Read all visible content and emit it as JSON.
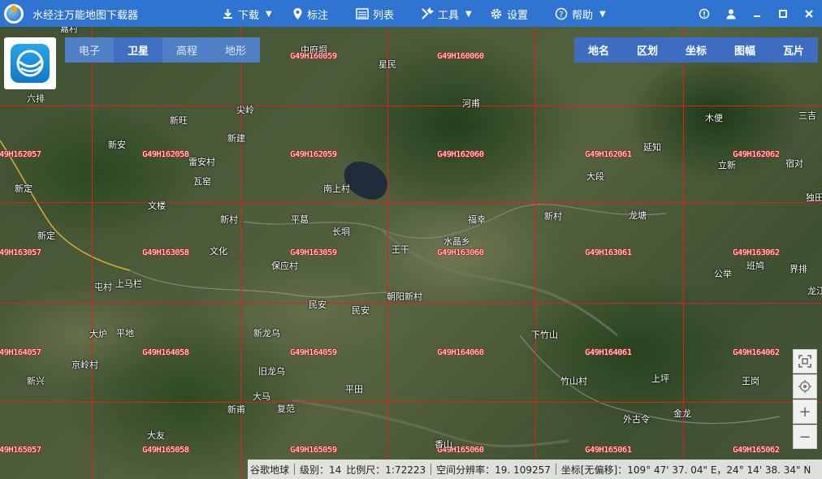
{
  "app": {
    "title": "水经注万能地图下载器"
  },
  "toolbar": {
    "download": "下载",
    "annotate": "标注",
    "list": "列表",
    "tools": "工具",
    "settings": "设置",
    "help": "帮助"
  },
  "map_types": [
    "电子",
    "卫星",
    "高程",
    "地形"
  ],
  "map_type_active": "卫星",
  "right_tools": [
    "地名",
    "区划",
    "坐标",
    "图幅",
    "瓦片"
  ],
  "tile_codes": [
    "G49H160059",
    "G49H160060",
    "G49H162057",
    "G49H162058",
    "G49H162059",
    "G49H162060",
    "G49H162061",
    "G49H162062",
    "G49H163057",
    "G49H163058",
    "G49H163059",
    "G49H163060",
    "G49H163061",
    "G49H163062",
    "G49H164057",
    "G49H164058",
    "G49H164059",
    "G49H164060",
    "G49H164061",
    "G49H164062",
    "G49H165057",
    "G49H165058",
    "G49H165059",
    "G49H165060",
    "G49H165061",
    "G49H165062"
  ],
  "places": [
    "嘉村",
    "中府垌",
    "星民",
    "六排",
    "尖岭",
    "河甫",
    "三吉",
    "新旺",
    "木便",
    "新安",
    "新建",
    "延知",
    "雷安村",
    "瓦窑",
    "立新",
    "宿对",
    "大段",
    "南上村",
    "新定",
    "独田",
    "文楼",
    "新村",
    "平葛",
    "龙塘",
    "新村",
    "福幸",
    "长垌",
    "新定",
    "水晶乡",
    "王干",
    "文化",
    "保应村",
    "班鸠",
    "公举",
    "界排",
    "屯村",
    "上马栏",
    "龙江",
    "朝阳新村",
    "民安",
    "民安",
    "大炉",
    "平地",
    "新龙乌",
    "下竹山",
    "京岭村",
    "新兴",
    "旧龙乌",
    "竹山村",
    "上坪",
    "王岗",
    "平田",
    "大马",
    "复范",
    "新甫",
    "外古令",
    "金龙",
    "大友",
    "香山"
  ],
  "zoom_controls": {
    "fullscreen": "fullscreen-icon",
    "locate": "locate-icon",
    "zoom_in": "+",
    "zoom_out": "−"
  },
  "status": {
    "source": "谷歌地球",
    "level": "级别：14",
    "scale": "比例尺：1:72223",
    "resolution": "空间分辨率：19. 109257",
    "coordinates": "坐标[无偏移]：109° 47' 37. 04\" E，24° 14' 38. 34\" N"
  },
  "colors": {
    "titlebar": "#2f74d0",
    "grid_line": "#e0201c",
    "tile_code_outline": "#c4161a"
  }
}
